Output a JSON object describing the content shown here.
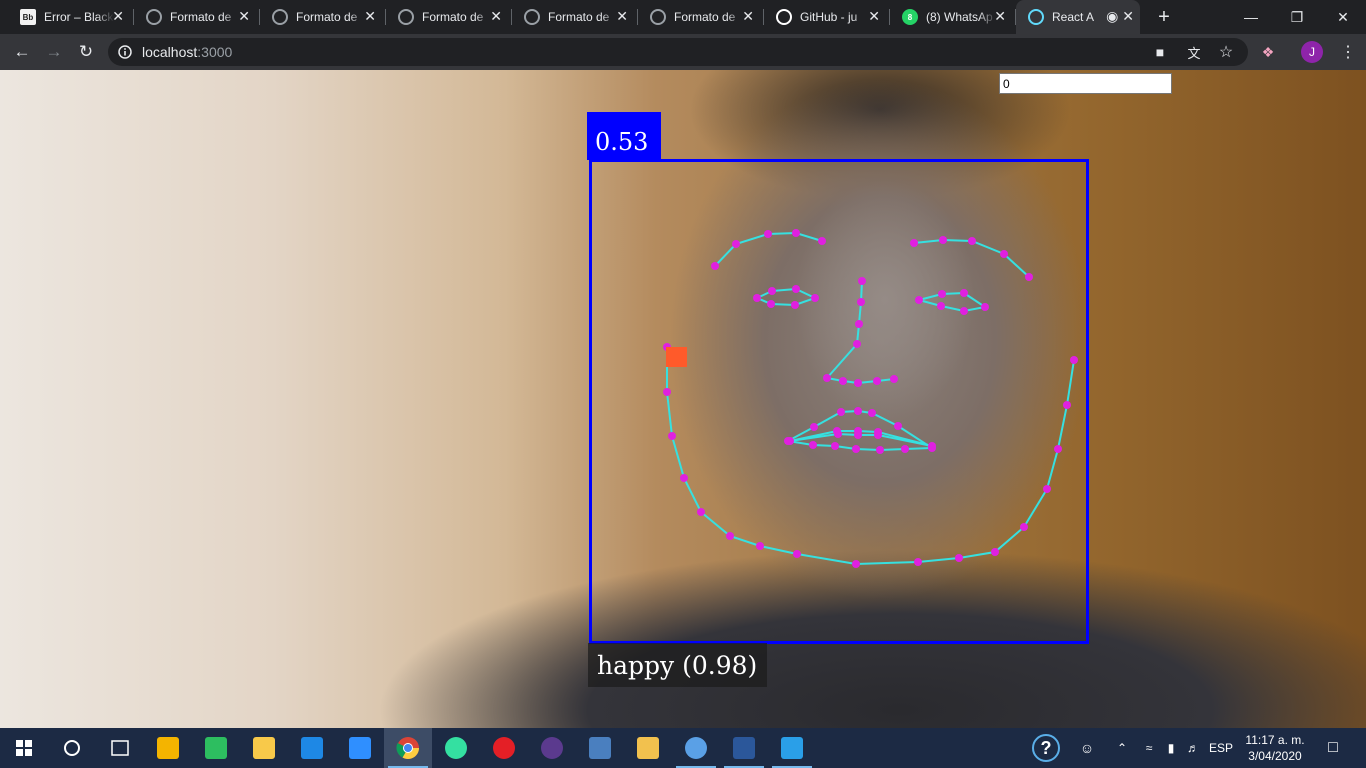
{
  "browser": {
    "tabs": [
      {
        "title": "Error – Blackboard",
        "favicon": "Bb",
        "favicon_color": "#f2f2f2",
        "favicon_text_color": "#222"
      },
      {
        "title": "Formato de",
        "favicon": "globe-icon",
        "favicon_color": "#9aa0a6"
      },
      {
        "title": "Formato de",
        "favicon": "globe-icon",
        "favicon_color": "#9aa0a6"
      },
      {
        "title": "Formato de",
        "favicon": "globe-icon",
        "favicon_color": "#9aa0a6"
      },
      {
        "title": "Formato de",
        "favicon": "globe-icon",
        "favicon_color": "#9aa0a6"
      },
      {
        "title": "Formato de",
        "favicon": "globe-icon",
        "favicon_color": "#9aa0a6"
      },
      {
        "title": "GitHub - ju",
        "favicon": "github-icon",
        "favicon_color": "#ffffff"
      },
      {
        "title": "(8) WhatsAp",
        "favicon": "8",
        "favicon_color": "#25d366",
        "favicon_text_color": "#fff"
      },
      {
        "title": "React A",
        "favicon": "react-icon",
        "favicon_color": "#61dafb",
        "active": true
      }
    ],
    "address": {
      "host": "localhost",
      "port": ":3000"
    },
    "profile_initial": "J",
    "profile_color": "#8e24aa"
  },
  "page": {
    "number_input_value": "0",
    "detection_score": "0.53",
    "expression_label": "happy (0.98)",
    "box_color": "#0000ff",
    "landmark_line_color": "#36e0e0",
    "landmark_point_color": "#e020e0",
    "marker_color": "#ff5a2a"
  },
  "taskbar": {
    "language": "ESP",
    "time": "11:17 a. m.",
    "date": "3/04/2020",
    "apps": [
      "start-icon",
      "cortana-icon",
      "task-view-icon",
      "store-icon",
      "evernote-icon",
      "file-explorer-icon",
      "edge-icon",
      "dropbox-icon",
      "chrome-icon",
      "tripadvisor-icon",
      "opera-icon",
      "eclipse-icon",
      "python-icon",
      "folder-tools-icon",
      "outlook-icon",
      "word-icon",
      "vscode-icon"
    ]
  }
}
